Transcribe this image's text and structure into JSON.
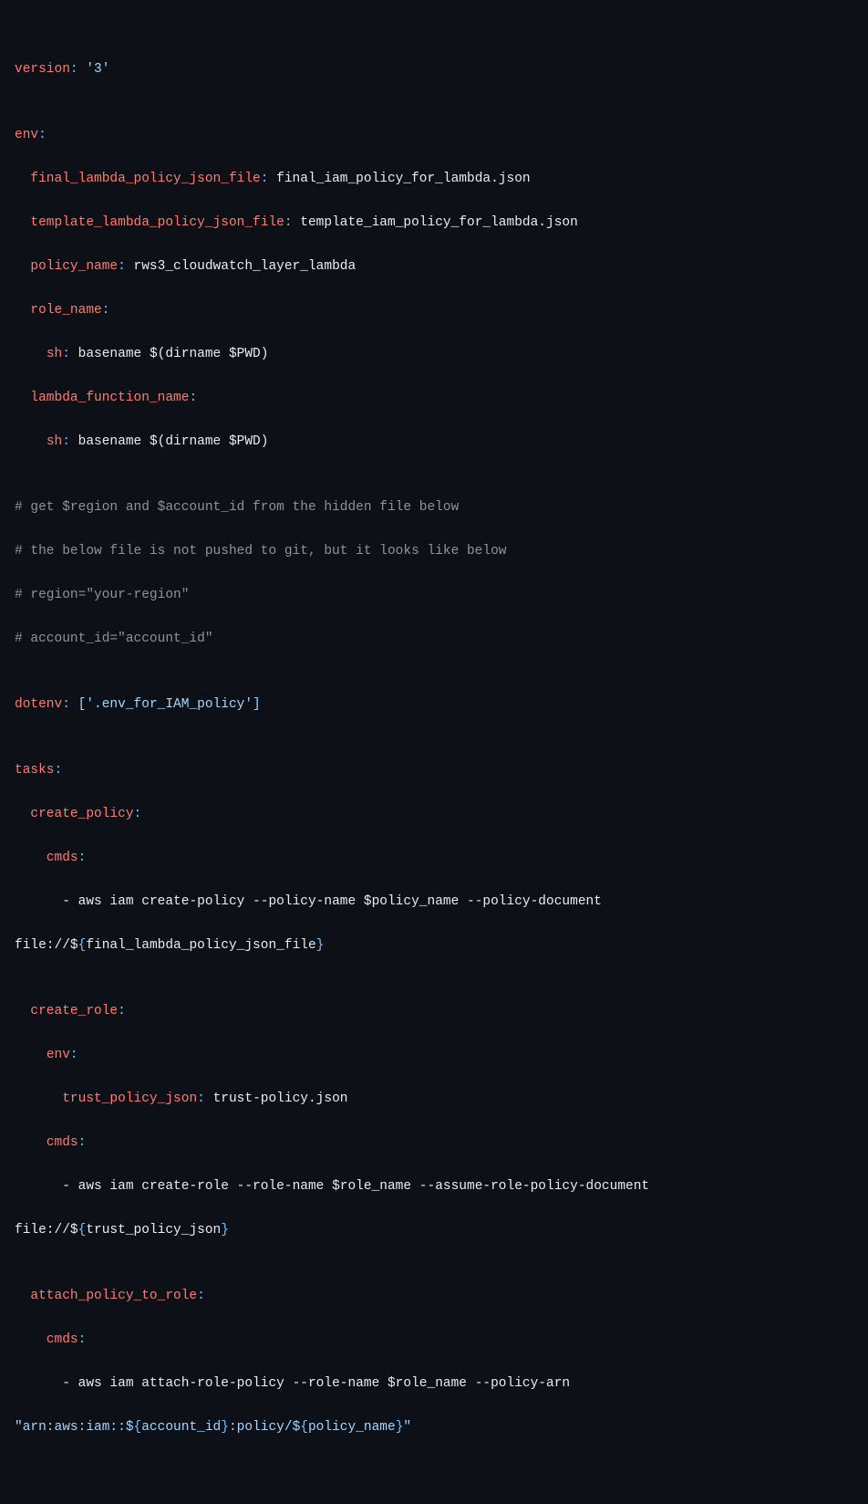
{
  "line1": {
    "k": "version",
    "v": "'3'"
  },
  "line2": {
    "k": "env"
  },
  "line3": {
    "k": "final_lambda_policy_json_file",
    "v": "final_iam_policy_for_lambda.json"
  },
  "line4": {
    "k": "template_lambda_policy_json_file",
    "v": "template_iam_policy_for_lambda.json"
  },
  "line5": {
    "k": "policy_name",
    "v": "rws3_cloudwatch_layer_lambda"
  },
  "line6": {
    "k": "role_name"
  },
  "line7": {
    "k": "sh",
    "v": "basename $(dirname $PWD)"
  },
  "line8": {
    "k": "lambda_function_name"
  },
  "line9": {
    "k": "sh",
    "v": "basename $(dirname $PWD)"
  },
  "comment1": "# get $region and $account_id from the hidden file below",
  "comment2": "# the below file is not pushed to git, but it looks like below",
  "comment3": "# region=\"your-region\"",
  "comment4": "# account_id=\"account_id\"",
  "line10": {
    "k": "dotenv",
    "v": "['.env_for_IAM_policy']"
  },
  "line11": {
    "k": "tasks"
  },
  "line12": {
    "k": "create_policy"
  },
  "line13": {
    "k": "cmds"
  },
  "cmd1a": "aws iam create-policy --policy-name $policy_name --policy-document ",
  "cmd1b_prefix": "file://$",
  "cmd1b_brace_open": "{",
  "cmd1b_var": "final_lambda_policy_json_file",
  "cmd1b_brace_close": "}",
  "line14": {
    "k": "create_role"
  },
  "line15": {
    "k": "env"
  },
  "line16": {
    "k": "trust_policy_json",
    "v": "trust-policy.json"
  },
  "line17": {
    "k": "cmds"
  },
  "cmd2a": "aws iam create-role --role-name $role_name --assume-role-policy-document ",
  "cmd2b_prefix": "file://$",
  "cmd2b_brace_open": "{",
  "cmd2b_var": "trust_policy_json",
  "cmd2b_brace_close": "}",
  "line18": {
    "k": "attach_policy_to_role"
  },
  "line19": {
    "k": "cmds"
  },
  "cmd3a": "aws iam attach-role-policy --role-name $role_name --policy-arn ",
  "cmd3b_qopen": "\"arn:aws:iam::$",
  "cmd3b_braceo1": "{",
  "cmd3b_var1": "account_id",
  "cmd3b_bracec1": "}",
  "cmd3b_mid": ":policy/$",
  "cmd3b_braceo2": "{",
  "cmd3b_var2": "policy_name",
  "cmd3b_bracec2": "}",
  "cmd3b_qclose": "\"",
  "colon": ":",
  "space": " ",
  "dash": "- "
}
